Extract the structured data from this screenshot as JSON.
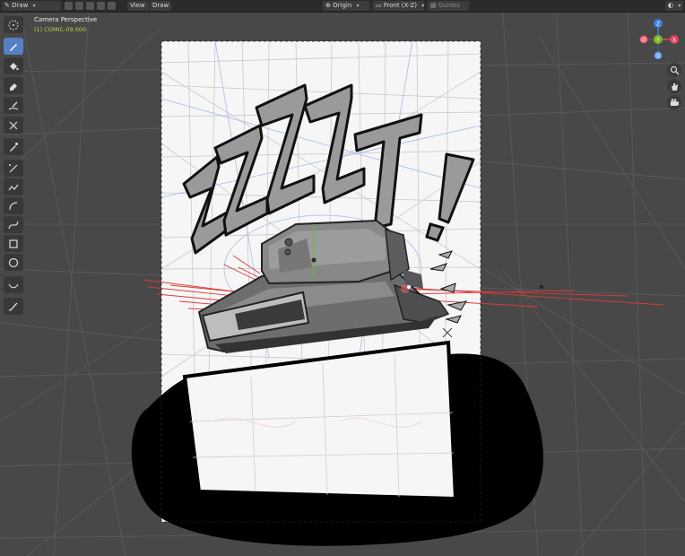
{
  "header": {
    "mode_label": "Draw",
    "view_menu": "View",
    "draw_menu": "Draw",
    "origin_label": "Origin",
    "front_label": "Front (X-Z)",
    "guides_label": "Guides"
  },
  "overlay": {
    "camera_title": "Camera Perspective",
    "object_name": "(1) COMIC-09.000"
  },
  "artwork": {
    "sfx_text": "ZZZZT!"
  },
  "gizmo": {
    "z": "Z",
    "y": "Y",
    "x": "X"
  },
  "toolbar_tools": [
    "select-circle",
    "draw",
    "fill",
    "erase",
    "tint",
    "cutter",
    "eyedropper",
    "line",
    "polyline",
    "arc",
    "curve",
    "box",
    "circle",
    "interpolate",
    "annotate"
  ],
  "colors": {
    "accent": "#5680c2",
    "object_name": "#b6d64a",
    "gizmo_x": "#e0445a",
    "gizmo_y": "#7ab82a",
    "gizmo_z": "#3f7fe0"
  }
}
